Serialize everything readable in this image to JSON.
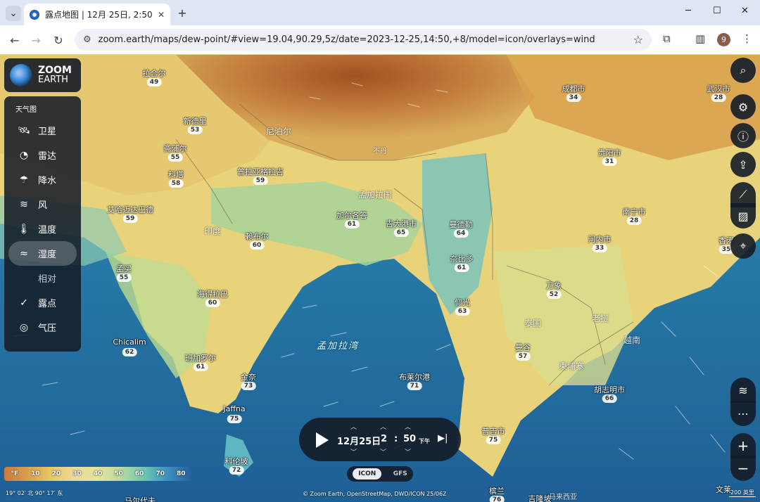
{
  "browser": {
    "tab_title": "露点地图 | 12月 25日, 2:50 下午",
    "url": "zoom.earth/maps/dew-point/#view=19.04,90.29,5z/date=2023-12-25,14:50,+8/model=icon/overlays=wind",
    "profile_initial": "9",
    "icons": [
      "chevron-down-icon",
      "close-icon",
      "plus-icon",
      "minimize-icon",
      "maximize-icon",
      "back-icon",
      "forward-icon",
      "reload-icon",
      "tune-icon",
      "star-icon",
      "extensions-icon",
      "sidebar-icon",
      "menu-icon"
    ]
  },
  "logo": {
    "line1": "ZOOM",
    "line2": "EARTH"
  },
  "layers": {
    "header": "天气图",
    "items": [
      {
        "label": "卫星",
        "icon": "satellite-icon"
      },
      {
        "label": "雷达",
        "icon": "radar-icon"
      },
      {
        "label": "降水",
        "icon": "precipitation-icon"
      },
      {
        "label": "风",
        "icon": "wind-icon"
      },
      {
        "label": "温度",
        "icon": "thermometer-icon"
      },
      {
        "label": "湿度",
        "icon": "humidity-icon"
      },
      {
        "label": "相对",
        "icon": ""
      },
      {
        "label": "露点",
        "icon": "check-icon"
      },
      {
        "label": "气压",
        "icon": "compass-icon"
      }
    ]
  },
  "map_labels": {
    "cities": [
      {
        "name": "拉合尔",
        "value": "49"
      },
      {
        "name": "新德里",
        "value": "53"
      },
      {
        "name": "斋浦尔",
        "value": "55"
      },
      {
        "name": "科塔",
        "value": "58"
      },
      {
        "name": "普拉亚格拉吉",
        "value": "59"
      },
      {
        "name": "艾哈迈达巴德",
        "value": "59"
      },
      {
        "name": "加尔各答",
        "value": "61"
      },
      {
        "name": "吉大港市",
        "value": "65"
      },
      {
        "name": "曼德勒",
        "value": "64"
      },
      {
        "name": "奈比多",
        "value": "61"
      },
      {
        "name": "赖布尔",
        "value": "60"
      },
      {
        "name": "孟买",
        "value": "55"
      },
      {
        "name": "海得拉巴",
        "value": "60"
      },
      {
        "name": "仰光",
        "value": "63"
      },
      {
        "name": "班加罗尔",
        "value": "61"
      },
      {
        "name": "Chicalim",
        "value": "62"
      },
      {
        "name": "金奈",
        "value": "73"
      },
      {
        "name": "Jaffna",
        "value": "75"
      },
      {
        "name": "科伦坡",
        "value": "72"
      },
      {
        "name": "布莱尔港",
        "value": "71"
      },
      {
        "name": "成都市",
        "value": "34"
      },
      {
        "name": "武汉市",
        "value": "28"
      },
      {
        "name": "贵阳市",
        "value": "31"
      },
      {
        "name": "南宁市",
        "value": "28"
      },
      {
        "name": "河内市",
        "value": "33"
      },
      {
        "name": "香港",
        "value": "35"
      },
      {
        "name": "万象",
        "value": "52"
      },
      {
        "name": "曼谷",
        "value": "57"
      },
      {
        "name": "胡志明市",
        "value": "66"
      },
      {
        "name": "普吉市",
        "value": "75"
      },
      {
        "name": "槟兰",
        "value": "76"
      },
      {
        "name": "马尔代夫",
        "value": ""
      },
      {
        "name": "吉隆坡",
        "value": ""
      },
      {
        "name": "文莱",
        "value": ""
      }
    ],
    "countries": [
      "尼泊尔",
      "不丹",
      "孟加拉国",
      "印度",
      "泰国",
      "老挝",
      "柬埔寨",
      "越南",
      "马来西亚"
    ],
    "seas": [
      "孟加拉湾"
    ]
  },
  "right_controls": [
    "search-icon",
    "gear-icon",
    "info-icon",
    "share-icon",
    "measure-icon",
    "region-icon",
    "locate-icon"
  ],
  "bottom_right": [
    "wind-overlay-icon",
    "more-icon",
    "zoom-in-icon",
    "zoom-out-icon"
  ],
  "time": {
    "date": "12月25日",
    "hour": "2",
    "sep": ":",
    "minute": "50",
    "ampm": "下午"
  },
  "models": {
    "active": "ICON",
    "other": "GFS"
  },
  "legend": {
    "unit": "°F",
    "ticks": [
      "10",
      "20",
      "30",
      "40",
      "50",
      "60",
      "70",
      "80"
    ],
    "colors": [
      "#c97a3e",
      "#d7a04c",
      "#e8c868",
      "#ecd99a",
      "#e6e39a",
      "#b7dc9c",
      "#6fc5b4",
      "#3c8fbf",
      "#2a5f9e"
    ]
  },
  "status": {
    "coords": "19° 02′ 北  90° 17′ 东",
    "attribution": "© Zoom Earth, OpenStreetMap, DWD/ICON 25/06Z",
    "scale": "200 英里"
  }
}
